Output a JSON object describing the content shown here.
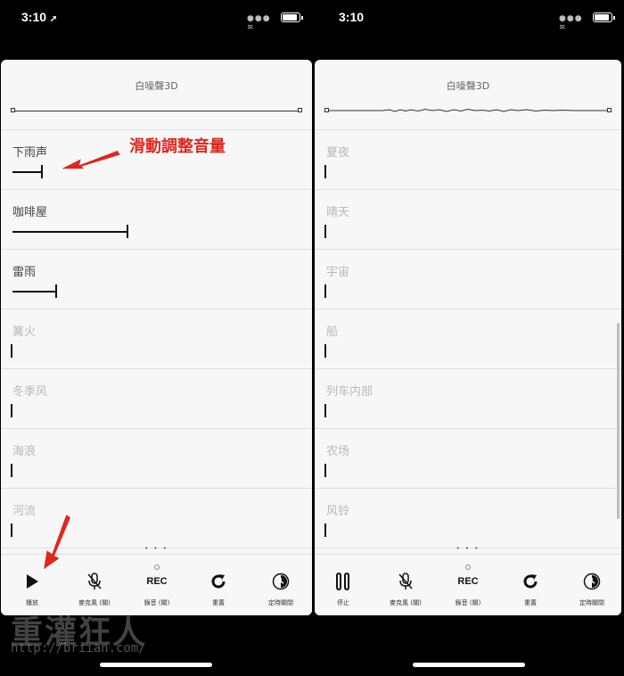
{
  "status_bar": {
    "left_time": "3:10",
    "right_time": "3:10"
  },
  "app_title": "白噪聲3D",
  "annotation_text": "滑動調整音量",
  "left_panel": {
    "master_volume": 1.0,
    "sounds": [
      {
        "label": "下雨声",
        "volume": 0.1,
        "active": true
      },
      {
        "label": "咖啡屋",
        "volume": 0.4,
        "active": true
      },
      {
        "label": "雷雨",
        "volume": 0.15,
        "active": true
      },
      {
        "label": "篝火",
        "volume": 0,
        "active": false
      },
      {
        "label": "冬季风",
        "volume": 0,
        "active": false
      },
      {
        "label": "海浪",
        "volume": 0,
        "active": false
      },
      {
        "label": "河流",
        "volume": 0,
        "active": false
      }
    ],
    "toolbar": {
      "play_label": "播放",
      "mic_label": "麥克風 (關)",
      "rec_label": "錄音 (關)",
      "rec_text": "REC",
      "reset_label": "重置",
      "timer_label": "定時關閉"
    }
  },
  "right_panel": {
    "master_volume": 1.0,
    "sounds": [
      {
        "label": "夏夜",
        "volume": 0,
        "active": false
      },
      {
        "label": "晴天",
        "volume": 0,
        "active": false
      },
      {
        "label": "宇宙",
        "volume": 0,
        "active": false
      },
      {
        "label": "船",
        "volume": 0,
        "active": false
      },
      {
        "label": "列车内部",
        "volume": 0,
        "active": false
      },
      {
        "label": "农场",
        "volume": 0,
        "active": false
      },
      {
        "label": "风铃",
        "volume": 0,
        "active": false
      }
    ],
    "toolbar": {
      "stop_label": "停止",
      "mic_label": "麥克風 (關)",
      "rec_label": "錄音 (關)",
      "rec_text": "REC",
      "reset_label": "重置",
      "timer_label": "定時關閉"
    }
  },
  "page_dots": "• • •",
  "watermark": {
    "text": "重灌狂人",
    "url": "http://briian.com/"
  },
  "colors": {
    "annotation": "#e0261e",
    "active_text": "#444444",
    "inactive_text": "#b9b9b9"
  }
}
